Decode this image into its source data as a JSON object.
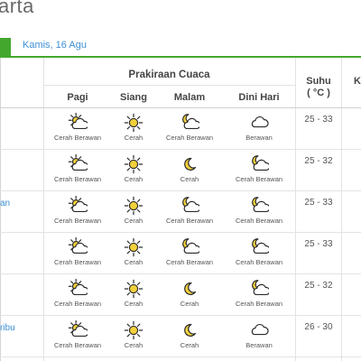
{
  "page": {
    "title": "arta"
  },
  "tabs": {
    "active_label": "",
    "date": "Kamis, 16 Agu"
  },
  "table": {
    "group_header": "Prakiraan Cuaca",
    "periods": [
      "Pagi",
      "Siang",
      "Malam",
      "Dini Hari"
    ],
    "temp_header_line1": "Suhu",
    "temp_header_line2": "( °C )",
    "extra_header": "K",
    "rows": [
      {
        "city": "",
        "temp": "25 - 33",
        "cells": [
          {
            "icon": "partly-cloudy-day-icon",
            "label": "Cerah Berawan"
          },
          {
            "icon": "sun-icon",
            "label": "Cerah"
          },
          {
            "icon": "partly-cloudy-night-icon",
            "label": "Cerah Berawan"
          },
          {
            "icon": "cloud-icon",
            "label": "Berawan"
          }
        ]
      },
      {
        "city": "",
        "temp": "25 - 32",
        "cells": [
          {
            "icon": "partly-cloudy-day-icon",
            "label": "Cerah Berawan"
          },
          {
            "icon": "sun-icon",
            "label": "Cerah"
          },
          {
            "icon": "moon-icon",
            "label": "Cerah"
          },
          {
            "icon": "partly-cloudy-night-icon",
            "label": "Cerah Berawan"
          }
        ]
      },
      {
        "city": "an",
        "temp": "25 - 33",
        "cells": [
          {
            "icon": "partly-cloudy-day-icon",
            "label": "Cerah Berawan"
          },
          {
            "icon": "sun-icon",
            "label": "Cerah"
          },
          {
            "icon": "partly-cloudy-night-icon",
            "label": "Cerah Berawan"
          },
          {
            "icon": "partly-cloudy-night-icon",
            "label": "Cerah Berawan"
          }
        ]
      },
      {
        "city": "",
        "temp": "25 - 33",
        "cells": [
          {
            "icon": "partly-cloudy-day-icon",
            "label": "Cerah Berawan"
          },
          {
            "icon": "sun-icon",
            "label": "Cerah"
          },
          {
            "icon": "partly-cloudy-night-icon",
            "label": "Cerah Berawan"
          },
          {
            "icon": "partly-cloudy-night-icon",
            "label": "Cerah Berawan"
          }
        ]
      },
      {
        "city": "",
        "temp": "25 - 32",
        "cells": [
          {
            "icon": "partly-cloudy-day-icon",
            "label": "Cerah Berawan"
          },
          {
            "icon": "sun-icon",
            "label": "Cerah"
          },
          {
            "icon": "moon-icon",
            "label": "Cerah"
          },
          {
            "icon": "partly-cloudy-night-icon",
            "label": "Cerah Berawan"
          }
        ]
      },
      {
        "city": "ribu",
        "temp": "26 - 30",
        "cells": [
          {
            "icon": "partly-cloudy-day-icon",
            "label": "Cerah Berawan"
          },
          {
            "icon": "sun-icon",
            "label": "Cerah"
          },
          {
            "icon": "moon-icon",
            "label": "Cerah"
          },
          {
            "icon": "cloud-icon",
            "label": "Berawan"
          }
        ]
      }
    ]
  },
  "colors": {
    "accent": "#43a72e",
    "link": "#3e8fd6",
    "icon_fill": "#f3d13b",
    "icon_stroke": "#2b2b2b"
  }
}
